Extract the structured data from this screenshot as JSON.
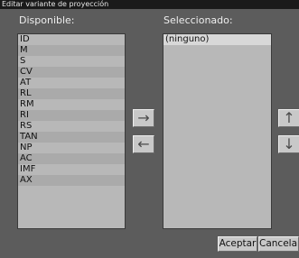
{
  "window": {
    "title": "Editar variante de proyección"
  },
  "available": {
    "label": "Disponible:",
    "items": [
      "ID",
      "M",
      "S",
      "CV",
      "AT",
      "RL",
      "RM",
      "RI",
      "RS",
      "TAN",
      "NP",
      "AC",
      "IMF",
      "AX"
    ]
  },
  "selected": {
    "label": "Seleccionado:",
    "items": [
      "(ninguno)"
    ]
  },
  "buttons": {
    "add_icon": "right-arrow",
    "add_glyph": "→",
    "remove_icon": "left-arrow",
    "remove_glyph": "←",
    "up_icon": "up-arrow",
    "up_glyph": "↑",
    "down_icon": "down-arrow",
    "down_glyph": "↓",
    "accept": "Aceptar",
    "cancel": "Cancelar"
  }
}
